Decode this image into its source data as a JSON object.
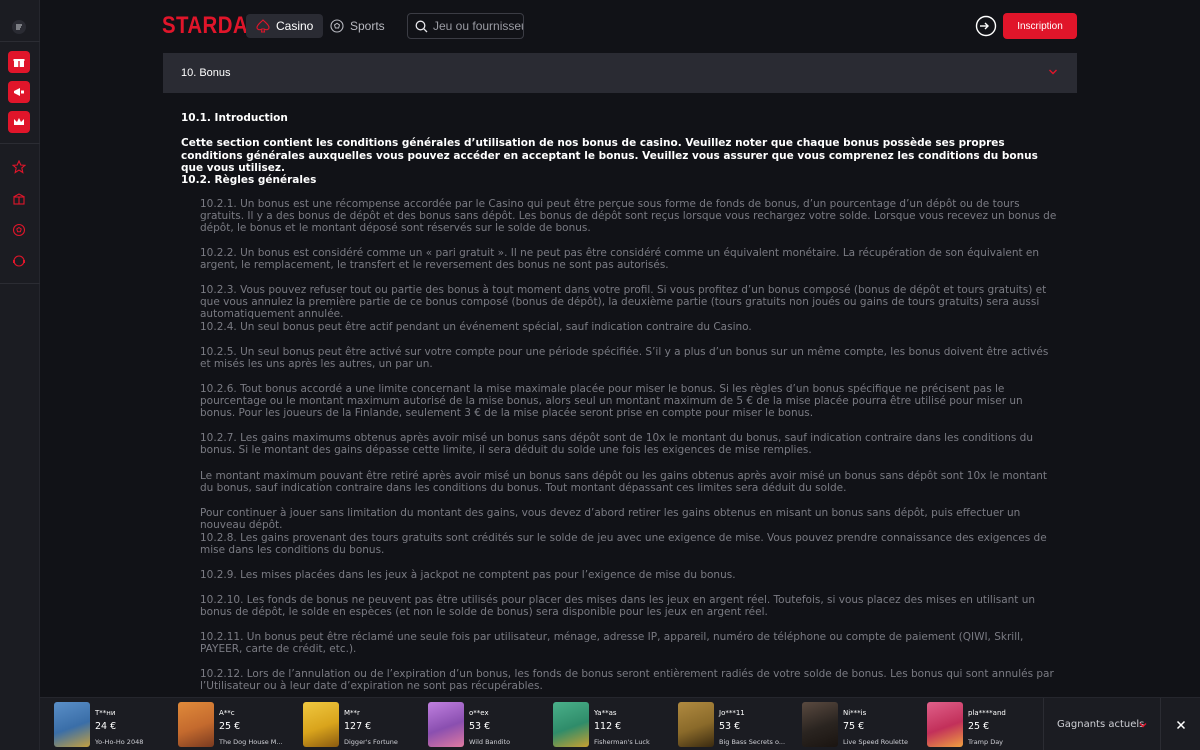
{
  "header": {
    "logo": "STARDA",
    "tab_casino": "Casino",
    "tab_sports": "Sports",
    "search_placeholder": "Jeu ou fournisseur",
    "inscription": "Inscription"
  },
  "sidebar": {
    "icons": [
      "menu-icon",
      "gift-icon",
      "megaphone-icon",
      "crown-icon",
      "star-icon",
      "box-icon",
      "ball-icon",
      "support-icon"
    ]
  },
  "section": {
    "title": "10. Bonus",
    "h_intro": "10.1.  Introduction",
    "intro": "Cette section contient les conditions générales d’utilisation de nos bonus de casino. Veuillez noter que chaque bonus possède ses propres conditions générales auxquelles vous pouvez accéder en acceptant le bonus. Veuillez vous assurer que vous comprenez les conditions du bonus que vous utilisez.",
    "h_rules": "10.2.  Règles générales",
    "paragraphs": [
      "10.2.1. Un bonus est une récompense accordée par le Casino qui peut être perçue sous forme de fonds de bonus, d’un pourcentage d’un dépôt ou de tours gratuits. Il y a des bonus de dépôt et des bonus sans dépôt. Les bonus de dépôt sont reçus lorsque vous rechargez votre solde. Lorsque vous recevez un bonus de dépôt, le bonus et le montant déposé sont réservés sur le solde de bonus.",
      "10.2.2. Un bonus est considéré comme un « pari gratuit ». Il ne peut pas être considéré comme un équivalent monétaire. La récupération de son équivalent en argent, le remplacement, le transfert et le reversement des bonus ne sont pas autorisés.",
      "10.2.3. Vous pouvez refuser tout ou partie des bonus à tout moment dans votre profil. Si vous profitez d’un bonus composé (bonus de dépôt et tours gratuits) et que vous annulez la première partie de ce bonus composé (bonus de dépôt), la deuxième partie (tours gratuits non joués ou gains de tours gratuits) sera aussi automatiquement annulée.",
      "10.2.4. Un seul bonus peut être actif pendant un événement spécial, sauf indication contraire du Casino.",
      "10.2.5. Un seul bonus peut être activé sur votre compte pour une période spécifiée. S’il y a plus d’un bonus sur un même compte, les bonus doivent être activés et misés les uns après les autres, un par un.",
      "10.2.6. Tout bonus accordé a une limite concernant la mise maximale placée pour miser le bonus. Si les règles d’un bonus spécifique ne précisent pas le pourcentage ou le montant maximum autorisé de la mise bonus, alors seul un montant maximum de 5 € de la mise placée pourra être utilisé pour miser un bonus. Pour les joueurs de la Finlande, seulement 3 € de la mise placée seront prise en compte pour miser le bonus.",
      "10.2.7. Les gains maximums obtenus après avoir misé un bonus sans dépôt sont de 10x le montant du bonus, sauf indication contraire dans les conditions du bonus. Si le montant des gains dépasse cette limite, il sera déduit du solde une fois les exigences de mise remplies.",
      "Le montant maximum pouvant être retiré après avoir misé un bonus sans dépôt ou les gains obtenus après avoir misé un bonus sans dépôt sont 10x le montant du bonus, sauf indication contraire dans les conditions du bonus. Tout montant dépassant ces limites sera déduit du solde.",
      "Pour continuer à jouer sans limitation du montant des gains, vous devez d’abord retirer les gains obtenus en misant un bonus sans dépôt, puis effectuer un nouveau dépôt.",
      "10.2.8. Les gains provenant des tours gratuits sont crédités sur le solde de jeu avec une exigence de mise. Vous pouvez prendre connaissance des exigences de mise dans les conditions du bonus.",
      "10.2.9. Les mises placées dans les jeux à jackpot ne comptent pas pour l’exigence de mise du bonus.",
      "10.2.10. Les fonds de bonus ne peuvent pas être utilisés pour placer des mises dans les jeux en argent réel. Toutefois, si vous placez des mises en utilisant un bonus de dépôt, le solde en espèces (et non le solde de bonus) sera disponible pour les jeux en argent réel.",
      "10.2.11. Un bonus peut être réclamé une seule fois par utilisateur, ménage, adresse IP, appareil, numéro de téléphone ou compte de paiement (QIWI, Skrill, PAYEER, carte de crédit, etc.).",
      "10.2.12. Lors de l’annulation ou de l’expiration d’un bonus, les fonds de bonus seront entièrement radiés de votre solde de bonus. Les bonus qui sont annulés par l’Utilisateur ou à leur date d’expiration ne sont pas récupérables."
    ]
  },
  "winners": {
    "label": "Gagnants actuels",
    "items": [
      {
        "name": "T**ни",
        "amount": "24 €",
        "game": "Yo-Ho-Ho 2048",
        "color": "#3a6ea8"
      },
      {
        "name": "A**c",
        "amount": "25 €",
        "game": "The Dog House M...",
        "color": "#c46a2e"
      },
      {
        "name": "M**r",
        "amount": "127 €",
        "game": "Digger's Fortune",
        "color": "#d9a41c"
      },
      {
        "name": "o**ex",
        "amount": "53 €",
        "game": "Wild Bandito",
        "color": "#8a4fb0"
      },
      {
        "name": "Ya**as",
        "amount": "112 €",
        "game": "Fisherman's Luck",
        "color": "#2f8c6a"
      },
      {
        "name": "Jo***11",
        "amount": "53 €",
        "game": "Big Bass Secrets o...",
        "color": "#8a6a2a"
      },
      {
        "name": "Ni***is",
        "amount": "75 €",
        "game": "Live Speed Roulette",
        "color": "#2a2420"
      },
      {
        "name": "pla****and",
        "amount": "25 €",
        "game": "Tramp Day",
        "color": "#c2305a"
      }
    ]
  }
}
